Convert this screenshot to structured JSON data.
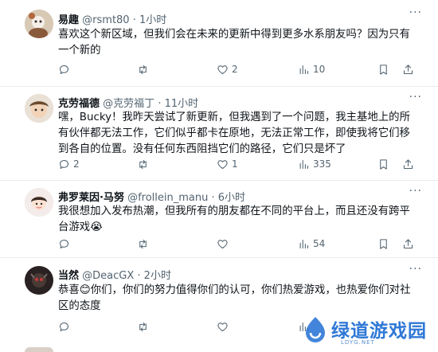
{
  "tweets": [
    {
      "name": "易趣",
      "handle": "@rsmt80",
      "time": "· 1小时",
      "text": "喜欢这个新区域，但我们会在未来的更新中得到更多水系朋友吗？因为只有一个新的",
      "replies": "",
      "retweets": "",
      "likes": "2",
      "views": "10"
    },
    {
      "name": "克劳福德",
      "handle": "@克劳福丁",
      "time": "· 11小时",
      "text": "嘿，Bucky！我昨天尝试了新更新，但我遇到了一个问题，我主基地上的所有伙伴都无法工作，它们似乎都卡在原地，无法正常工作，即使我将它们移到各自的位置。没有任何东西阻挡它们的路径，它们只是坏了",
      "replies": "2",
      "retweets": "",
      "likes": "1",
      "views": "335"
    },
    {
      "name": "弗罗莱因·马努",
      "handle": "@frollein_manu",
      "time": "· 6小时",
      "text": "我很想加入发布热潮，但我所有的朋友都在不同的平台上，而且还没有跨平台游戏😭",
      "replies": "",
      "retweets": "",
      "likes": "",
      "views": "54"
    },
    {
      "name": "当然",
      "handle": "@DeacGX",
      "time": "· 2小时",
      "text": "恭喜😊你们，你们的努力值得你们的认可，你们热爱游戏，也热爱你们对社区的态度",
      "replies": "",
      "retweets": "",
      "likes": "",
      "views": ""
    }
  ],
  "more_glyph": "···",
  "watermark": {
    "title": "绿道游戏园",
    "subtitle": "LDYG.NET"
  },
  "icons": {
    "reply": "comment-icon",
    "retweet": "retweet-icon",
    "like": "heart-icon",
    "views": "views-chart-icon",
    "bookmark": "bookmark-icon",
    "share": "share-icon"
  },
  "colors": {
    "text": "#0f1419",
    "muted": "#536471",
    "divider": "#e6ecf0",
    "watermark": "#2f78d6"
  }
}
